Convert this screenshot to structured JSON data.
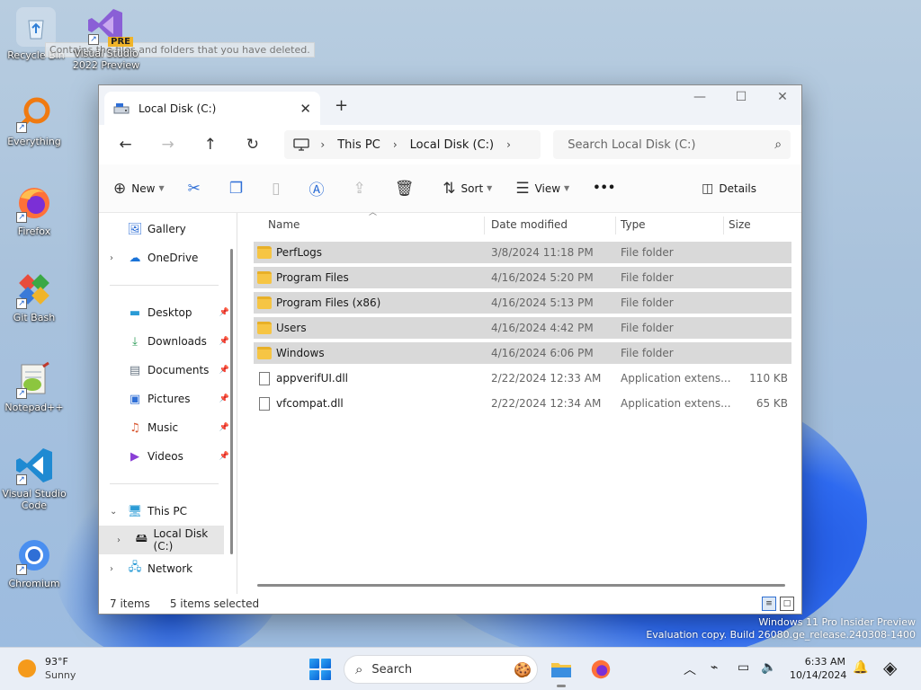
{
  "desktop": {
    "icons": [
      {
        "label": "Recycle Bin",
        "icon": "recycle-bin-icon"
      },
      {
        "label": "Visual Studio 2022 Preview",
        "badge": "PRE",
        "icon": "visual-studio-icon"
      },
      {
        "label": "Everything",
        "icon": "everything-search-icon"
      },
      {
        "label": "Firefox",
        "icon": "firefox-icon"
      },
      {
        "label": "Git Bash",
        "icon": "git-bash-icon"
      },
      {
        "label": "Notepad++",
        "icon": "notepad-plus-plus-icon"
      },
      {
        "label": "Visual Studio Code",
        "icon": "vscode-icon"
      },
      {
        "label": "Chromium",
        "icon": "chromium-icon"
      }
    ],
    "tooltip": "Contains the files and folders that you have deleted."
  },
  "window": {
    "tab_title": "Local Disk (C:)",
    "controls": {
      "minimize": "—",
      "maximize": "☐",
      "close": "✕"
    }
  },
  "address": {
    "crumbs": [
      "This PC",
      "Local Disk (C:)"
    ],
    "search_placeholder": "Search Local Disk (C:)"
  },
  "toolbar": {
    "new_label": "New",
    "sort_label": "Sort",
    "view_label": "View",
    "more_label": "•••",
    "details_label": "Details"
  },
  "nav": {
    "gallery": "Gallery",
    "onedrive": "OneDrive",
    "desktop": "Desktop",
    "downloads": "Downloads",
    "documents": "Documents",
    "pictures": "Pictures",
    "music": "Music",
    "videos": "Videos",
    "thispc": "This PC",
    "localdisk": "Local Disk (C:)",
    "network": "Network"
  },
  "columns": {
    "name": "Name",
    "date": "Date modified",
    "type": "Type",
    "size": "Size"
  },
  "files": [
    {
      "name": "PerfLogs",
      "date": "3/8/2024 11:18 PM",
      "type": "File folder",
      "size": "",
      "selected": true
    },
    {
      "name": "Program Files",
      "date": "4/16/2024 5:20 PM",
      "type": "File folder",
      "size": "",
      "selected": true
    },
    {
      "name": "Program Files (x86)",
      "date": "4/16/2024 5:13 PM",
      "type": "File folder",
      "size": "",
      "selected": true
    },
    {
      "name": "Users",
      "date": "4/16/2024 4:42 PM",
      "type": "File folder",
      "size": "",
      "selected": true
    },
    {
      "name": "Windows",
      "date": "4/16/2024 6:06 PM",
      "type": "File folder",
      "size": "",
      "selected": true
    },
    {
      "name": "appverifUI.dll",
      "date": "2/22/2024 12:33 AM",
      "type": "Application extens...",
      "size": "110 KB",
      "selected": false
    },
    {
      "name": "vfcompat.dll",
      "date": "2/22/2024 12:34 AM",
      "type": "Application extens...",
      "size": "65 KB",
      "selected": false
    }
  ],
  "status": {
    "count": "7 items",
    "selected": "5 items selected"
  },
  "watermark": {
    "line1": "Windows 11 Pro Insider Preview",
    "line2": "Evaluation copy. Build 26080.ge_release.240308-1400"
  },
  "taskbar": {
    "temp": "93°F",
    "condition": "Sunny",
    "search_label": "Search",
    "time": "6:33 AM",
    "date": "10/14/2024"
  }
}
